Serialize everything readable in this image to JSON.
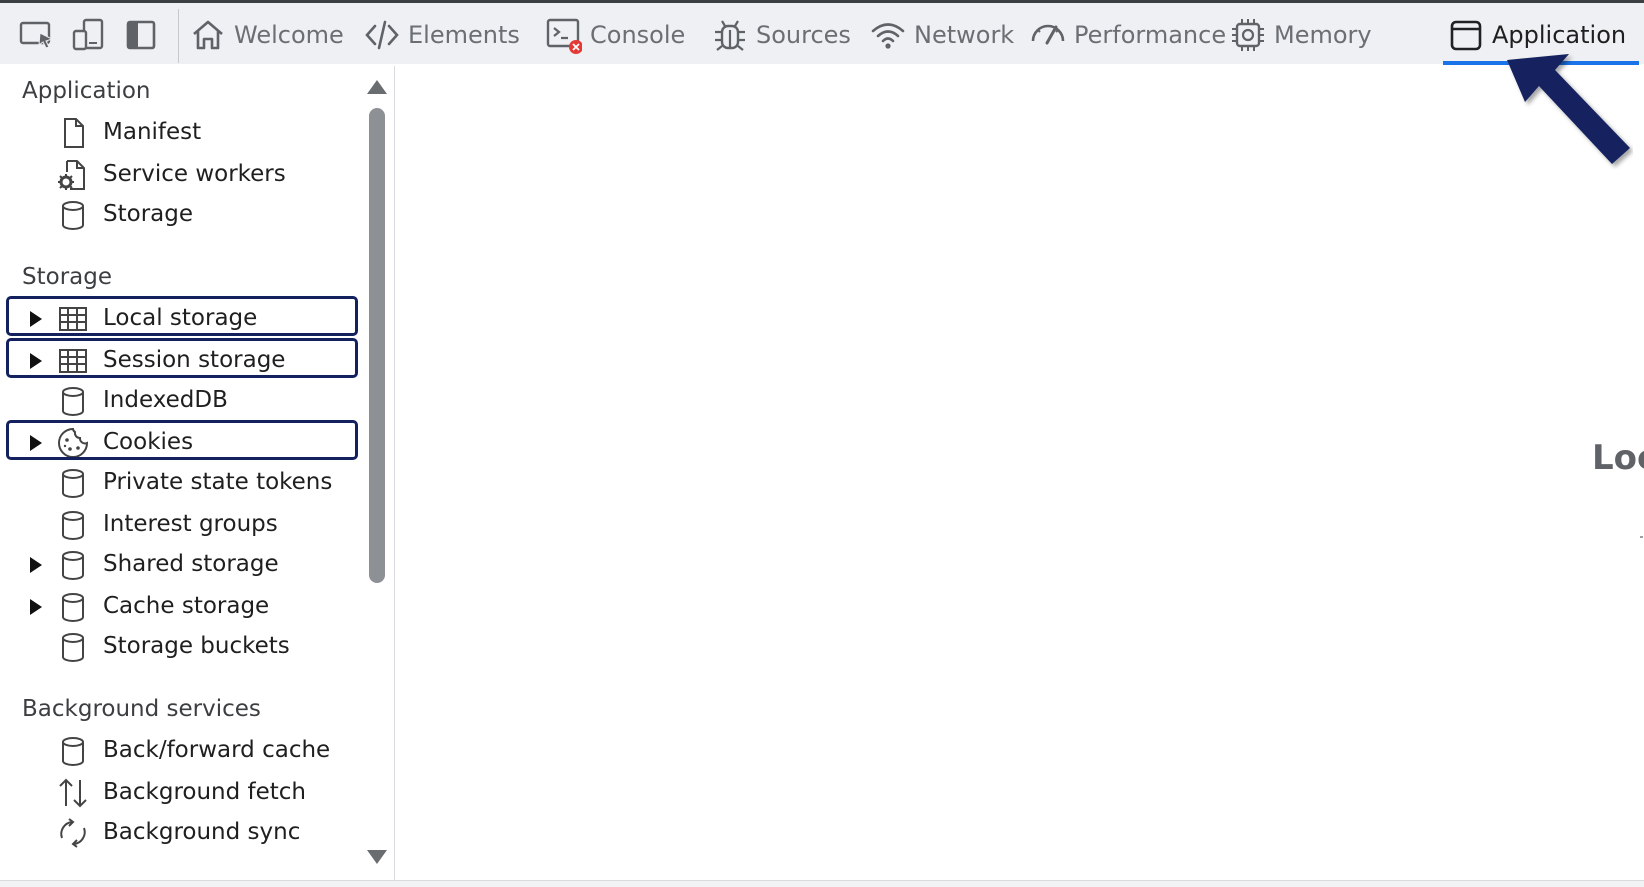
{
  "toolbar": {
    "tabs": [
      {
        "label": "Welcome",
        "icon": "home-icon"
      },
      {
        "label": "Elements",
        "icon": "code-icon"
      },
      {
        "label": "Console",
        "icon": "console-icon"
      },
      {
        "label": "Sources",
        "icon": "bug-icon"
      },
      {
        "label": "Network",
        "icon": "wifi-icon"
      },
      {
        "label": "Performance",
        "icon": "gauge-icon"
      },
      {
        "label": "Memory",
        "icon": "chip-icon"
      },
      {
        "label": "Application",
        "icon": "app-window-icon",
        "active": true
      }
    ],
    "active_underline_color": "#1a73e8",
    "console_error_badge_color": "#e53935"
  },
  "sidebar": {
    "sections": [
      {
        "title": "Application",
        "items": [
          {
            "label": "Manifest",
            "icon": "file-icon"
          },
          {
            "label": "Service workers",
            "icon": "gear-file-icon"
          },
          {
            "label": "Storage",
            "icon": "database-icon"
          }
        ]
      },
      {
        "title": "Storage",
        "items": [
          {
            "label": "Local storage",
            "icon": "grid-icon",
            "expandable": true,
            "highlighted": true
          },
          {
            "label": "Session storage",
            "icon": "grid-icon",
            "expandable": true,
            "highlighted": true
          },
          {
            "label": "IndexedDB",
            "icon": "database-icon"
          },
          {
            "label": "Cookies",
            "icon": "cookie-icon",
            "expandable": true,
            "highlighted": true
          },
          {
            "label": "Private state tokens",
            "icon": "database-icon"
          },
          {
            "label": "Interest groups",
            "icon": "database-icon"
          },
          {
            "label": "Shared storage",
            "icon": "database-icon",
            "expandable": true
          },
          {
            "label": "Cache storage",
            "icon": "database-icon",
            "expandable": true
          },
          {
            "label": "Storage buckets",
            "icon": "database-icon"
          }
        ]
      },
      {
        "title": "Background services",
        "items": [
          {
            "label": "Back/forward cache",
            "icon": "database-icon"
          },
          {
            "label": "Background fetch",
            "icon": "up-down-arrows-icon"
          },
          {
            "label": "Background sync",
            "icon": "sync-icon"
          }
        ]
      }
    ],
    "highlight_color": "#13215e"
  },
  "main": {
    "heading_partial": "Loc"
  },
  "annotation": {
    "arrow_color": "#13215e"
  }
}
